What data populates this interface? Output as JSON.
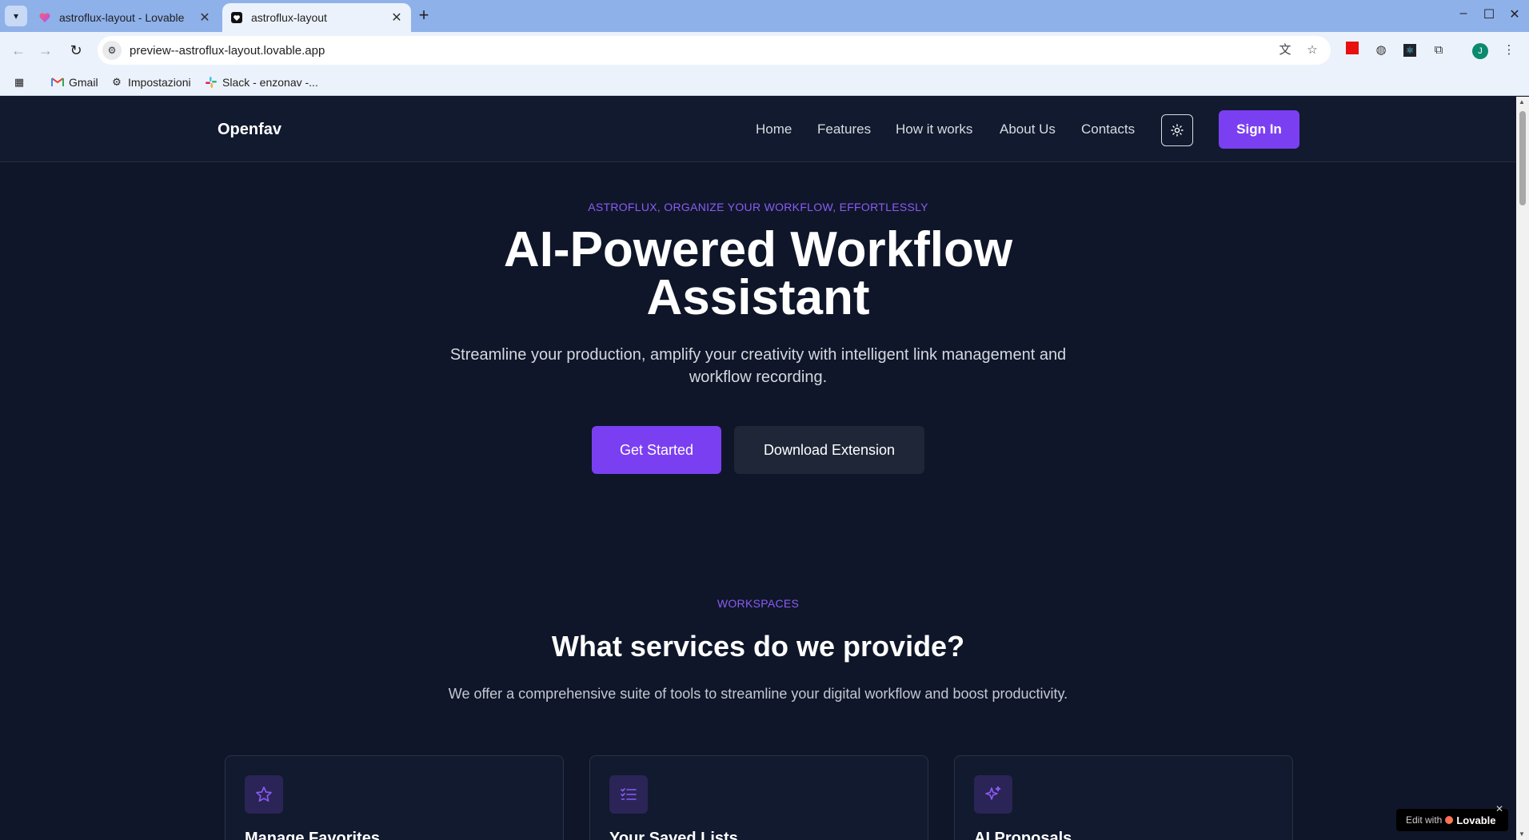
{
  "browser": {
    "tabs": [
      {
        "title": "astroflux-layout - Lovable",
        "active": false
      },
      {
        "title": "astroflux-layout",
        "active": true
      }
    ],
    "url": "preview--astroflux-layout.lovable.app",
    "bookmarks": [
      {
        "label": "Gmail",
        "icon": "gmail-icon"
      },
      {
        "label": "Impostazioni",
        "icon": "gear-icon"
      },
      {
        "label": "Slack - enzonav -...",
        "icon": "slack-icon"
      }
    ],
    "profile_initial": "J"
  },
  "site": {
    "brand": "Openfav",
    "nav": [
      "Home",
      "Features",
      "How it works",
      "About Us",
      "Contacts"
    ],
    "sign_in": "Sign In",
    "accent_color": "#7b3ff2"
  },
  "hero": {
    "eyebrow": "ASTROFLUX, ORGANIZE YOUR WORKFLOW, EFFORTLESSLY",
    "title_line1": "AI-Powered Workflow",
    "title_line2": "Assistant",
    "subtitle_line1": "Streamline your production, amplify your creativity with intelligent link management and",
    "subtitle_line2": "workflow recording.",
    "cta_primary": "Get Started",
    "cta_secondary": "Download Extension"
  },
  "services": {
    "eyebrow": "WORKSPACES",
    "title": "What services do we provide?",
    "subtitle": "We offer a comprehensive suite of tools to streamline your digital workflow and boost productivity.",
    "cards": [
      {
        "title": "Manage Favorites",
        "icon": "star-icon"
      },
      {
        "title": "Your Saved Lists",
        "icon": "checklist-icon"
      },
      {
        "title": "AI Proposals",
        "icon": "sparkles-icon"
      }
    ]
  },
  "badge": {
    "prefix": "Edit with",
    "brand": "Lovable"
  }
}
